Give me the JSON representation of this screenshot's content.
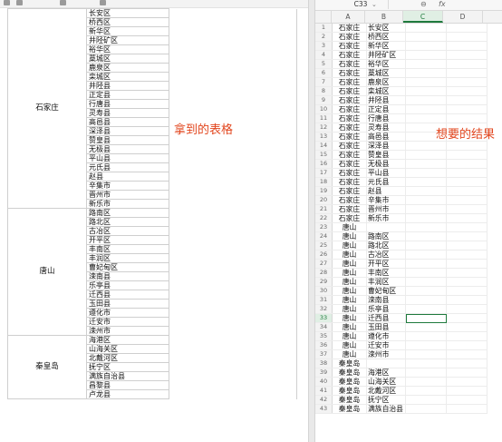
{
  "left": {
    "annotation": "拿到的表格",
    "groups": [
      {
        "province": "石家庄",
        "districts": [
          "长安区",
          "桥西区",
          "新华区",
          "井陉矿区",
          "裕华区",
          "藁城区",
          "鹿泉区",
          "栾城区",
          "井陉县",
          "正定县",
          "行唐县",
          "灵寿县",
          "高邑县",
          "深泽县",
          "赞皇县",
          "无极县",
          "平山县",
          "元氏县",
          "赵县",
          "辛集市",
          "晋州市",
          "新乐市"
        ]
      },
      {
        "province": "唐山",
        "districts": [
          "路南区",
          "路北区",
          "古冶区",
          "开平区",
          "丰南区",
          "丰润区",
          "曹妃甸区",
          "滦南县",
          "乐亭县",
          "迁西县",
          "玉田县",
          "遵化市",
          "迁安市",
          "滦州市"
        ]
      },
      {
        "province": "秦皇岛",
        "districts": [
          "海港区",
          "山海关区",
          "北戴河区",
          "抚宁区",
          "满族自治县",
          "昌黎县",
          "卢龙县"
        ]
      }
    ]
  },
  "right": {
    "annotation": "想要的结果",
    "name_box": "C33",
    "fx_label": "fx",
    "columns": [
      "A",
      "B",
      "C",
      "D"
    ],
    "selected_row": 33,
    "rows": [
      {
        "n": "1",
        "a": "石家庄",
        "b": "长安区"
      },
      {
        "n": "2",
        "a": "石家庄",
        "b": "桥西区"
      },
      {
        "n": "3",
        "a": "石家庄",
        "b": "新华区"
      },
      {
        "n": "4",
        "a": "石家庄",
        "b": "井陉矿区"
      },
      {
        "n": "5",
        "a": "石家庄",
        "b": "裕华区"
      },
      {
        "n": "6",
        "a": "石家庄",
        "b": "藁城区"
      },
      {
        "n": "7",
        "a": "石家庄",
        "b": "鹿泉区"
      },
      {
        "n": "8",
        "a": "石家庄",
        "b": "栾城区"
      },
      {
        "n": "9",
        "a": "石家庄",
        "b": "井陉县"
      },
      {
        "n": "10",
        "a": "石家庄",
        "b": "正定县"
      },
      {
        "n": "11",
        "a": "石家庄",
        "b": "行唐县"
      },
      {
        "n": "12",
        "a": "石家庄",
        "b": "灵寿县"
      },
      {
        "n": "13",
        "a": "石家庄",
        "b": "高邑县"
      },
      {
        "n": "14",
        "a": "石家庄",
        "b": "深泽县"
      },
      {
        "n": "15",
        "a": "石家庄",
        "b": "赞皇县"
      },
      {
        "n": "16",
        "a": "石家庄",
        "b": "无极县"
      },
      {
        "n": "17",
        "a": "石家庄",
        "b": "平山县"
      },
      {
        "n": "18",
        "a": "石家庄",
        "b": "元氏县"
      },
      {
        "n": "19",
        "a": "石家庄",
        "b": "赵县"
      },
      {
        "n": "20",
        "a": "石家庄",
        "b": "辛集市"
      },
      {
        "n": "21",
        "a": "石家庄",
        "b": "晋州市"
      },
      {
        "n": "22",
        "a": "石家庄",
        "b": "新乐市"
      },
      {
        "n": "23",
        "a": "唐山",
        "b": ""
      },
      {
        "n": "24",
        "a": "唐山",
        "b": "路南区"
      },
      {
        "n": "25",
        "a": "唐山",
        "b": "路北区"
      },
      {
        "n": "26",
        "a": "唐山",
        "b": "古冶区"
      },
      {
        "n": "27",
        "a": "唐山",
        "b": "开平区"
      },
      {
        "n": "28",
        "a": "唐山",
        "b": "丰南区"
      },
      {
        "n": "29",
        "a": "唐山",
        "b": "丰润区"
      },
      {
        "n": "30",
        "a": "唐山",
        "b": "曹妃甸区"
      },
      {
        "n": "31",
        "a": "唐山",
        "b": "滦南县"
      },
      {
        "n": "32",
        "a": "唐山",
        "b": "乐亭县"
      },
      {
        "n": "33",
        "a": "唐山",
        "b": "迁西县"
      },
      {
        "n": "34",
        "a": "唐山",
        "b": "玉田县"
      },
      {
        "n": "35",
        "a": "唐山",
        "b": "遵化市"
      },
      {
        "n": "36",
        "a": "唐山",
        "b": "迁安市"
      },
      {
        "n": "37",
        "a": "唐山",
        "b": "滦州市"
      },
      {
        "n": "38",
        "a": "秦皇岛",
        "b": ""
      },
      {
        "n": "39",
        "a": "秦皇岛",
        "b": "海港区"
      },
      {
        "n": "40",
        "a": "秦皇岛",
        "b": "山海关区"
      },
      {
        "n": "41",
        "a": "秦皇岛",
        "b": "北戴河区"
      },
      {
        "n": "42",
        "a": "秦皇岛",
        "b": "抚宁区"
      },
      {
        "n": "43",
        "a": "秦皇岛",
        "b": "满族自治县"
      }
    ]
  }
}
